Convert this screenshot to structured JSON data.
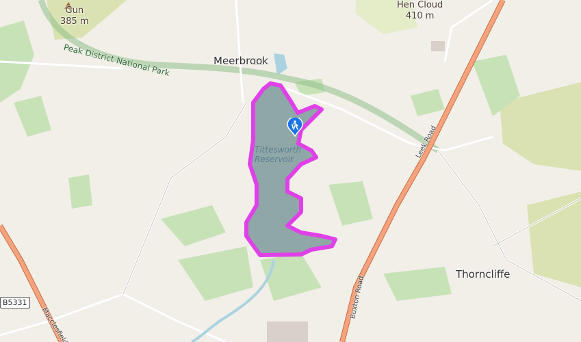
{
  "map": {
    "places": {
      "meerbrook": "Meerbrook",
      "thorncliffe": "Thorncliffe"
    },
    "peaks": {
      "gun_name": "Gun",
      "gun_elevation": "385 m",
      "hen_cloud_name": "Hen Cloud",
      "hen_cloud_elevation": "410 m"
    },
    "park_boundary_label": "Peak District National Park",
    "roads": {
      "leek_road": "Leek Road",
      "buxton_road": "Buxton Road",
      "macclesfield": "Macclesfield",
      "b5331": "B5331"
    },
    "water": {
      "line1": "Tittesworth",
      "line2": "Reservoir"
    },
    "colors": {
      "route": "#e040e8",
      "water": "#aad3df",
      "woodland": "#add19e",
      "park_boundary": "#8fbf8b",
      "major_road": "#e8926a",
      "background": "#f2efe9",
      "marker": "#1a73e8"
    },
    "marker_icon": "hiker-icon"
  }
}
